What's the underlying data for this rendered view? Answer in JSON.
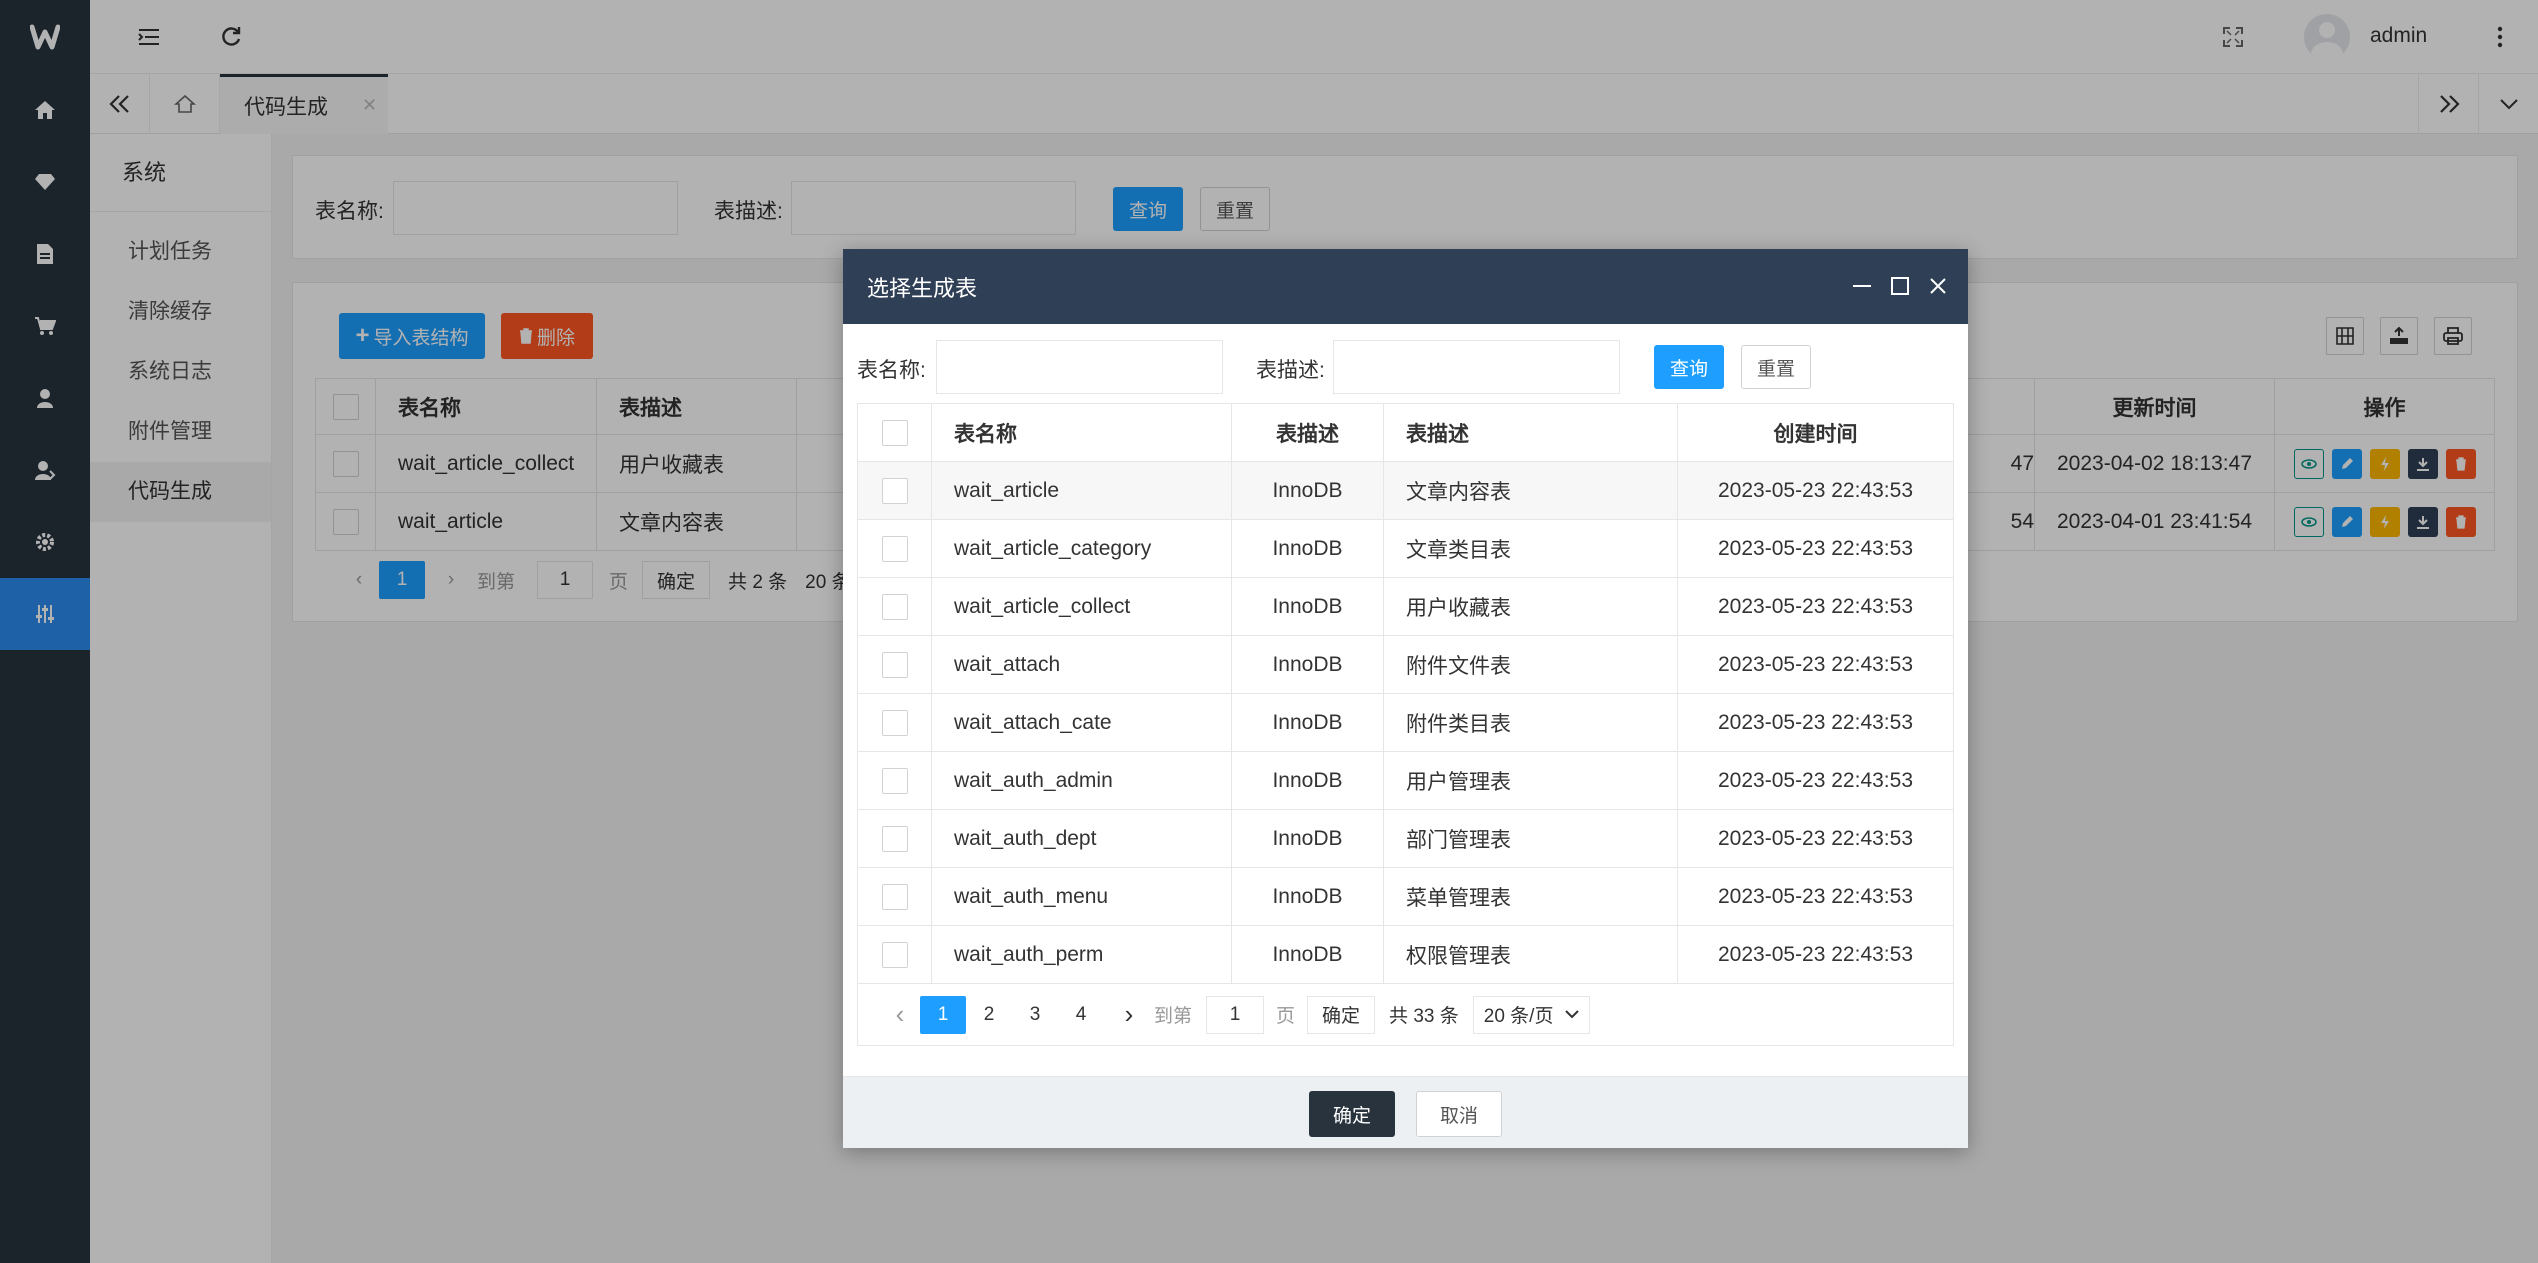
{
  "app": {
    "logo": "w",
    "user_name": "admin"
  },
  "nav_icons": [
    "home-icon",
    "diamond-icon",
    "document-icon",
    "cart-icon",
    "user-icon",
    "user-group-icon",
    "gear-icon",
    "sliders-icon"
  ],
  "tabs": {
    "active_label": "代码生成"
  },
  "side_menu": {
    "title": "系统",
    "items": [
      {
        "label": "计划任务"
      },
      {
        "label": "清除缓存"
      },
      {
        "label": "系统日志"
      },
      {
        "label": "附件管理"
      },
      {
        "label": "代码生成"
      }
    ]
  },
  "search": {
    "name_label": "表名称:",
    "desc_label": "表描述:",
    "query_label": "查询",
    "reset_label": "重置"
  },
  "toolbar": {
    "import_label": "导入表结构",
    "delete_label": "删除"
  },
  "main_table": {
    "headers": {
      "name": "表名称",
      "desc": "表描述",
      "updated": "更新时间",
      "ops": "操作"
    },
    "rows": [
      {
        "name": "wait_article_collect",
        "desc": "用户收藏表",
        "created_tail": "47",
        "updated": "2023-04-02 18:13:47"
      },
      {
        "name": "wait_article",
        "desc": "文章内容表",
        "created_tail": "54",
        "updated": "2023-04-01 23:41:54"
      }
    ],
    "pager": {
      "current": "1",
      "goto_label": "到第",
      "goto_value": "1",
      "page_label": "页",
      "confirm_label": "确定",
      "total": "共 2 条",
      "size_partial": "20 条"
    }
  },
  "modal": {
    "title": "选择生成表",
    "search": {
      "name_label": "表名称:",
      "desc_label": "表描述:",
      "query_label": "查询",
      "reset_label": "重置"
    },
    "headers": {
      "name": "表名称",
      "engine": "表描述",
      "desc": "表描述",
      "created": "创建时间"
    },
    "rows": [
      {
        "name": "wait_article",
        "engine": "InnoDB",
        "desc": "文章内容表",
        "created": "2023-05-23 22:43:53"
      },
      {
        "name": "wait_article_category",
        "engine": "InnoDB",
        "desc": "文章类目表",
        "created": "2023-05-23 22:43:53"
      },
      {
        "name": "wait_article_collect",
        "engine": "InnoDB",
        "desc": "用户收藏表",
        "created": "2023-05-23 22:43:53"
      },
      {
        "name": "wait_attach",
        "engine": "InnoDB",
        "desc": "附件文件表",
        "created": "2023-05-23 22:43:53"
      },
      {
        "name": "wait_attach_cate",
        "engine": "InnoDB",
        "desc": "附件类目表",
        "created": "2023-05-23 22:43:53"
      },
      {
        "name": "wait_auth_admin",
        "engine": "InnoDB",
        "desc": "用户管理表",
        "created": "2023-05-23 22:43:53"
      },
      {
        "name": "wait_auth_dept",
        "engine": "InnoDB",
        "desc": "部门管理表",
        "created": "2023-05-23 22:43:53"
      },
      {
        "name": "wait_auth_menu",
        "engine": "InnoDB",
        "desc": "菜单管理表",
        "created": "2023-05-23 22:43:53"
      },
      {
        "name": "wait_auth_perm",
        "engine": "InnoDB",
        "desc": "权限管理表",
        "created": "2023-05-23 22:43:53"
      }
    ],
    "pager": {
      "pages": [
        "1",
        "2",
        "3",
        "4"
      ],
      "goto_label": "到第",
      "goto_value": "1",
      "page_label": "页",
      "confirm_label": "确定",
      "total": "共 33 条",
      "size": "20 条/页"
    },
    "confirm_label": "确定",
    "cancel_label": "取消"
  },
  "colors": {
    "nav_bg": "#28333e",
    "accent": "#2d8cf0",
    "primary_btn": "#1e9fff",
    "modal_header": "#2f4056",
    "danger": "#ff5722"
  }
}
